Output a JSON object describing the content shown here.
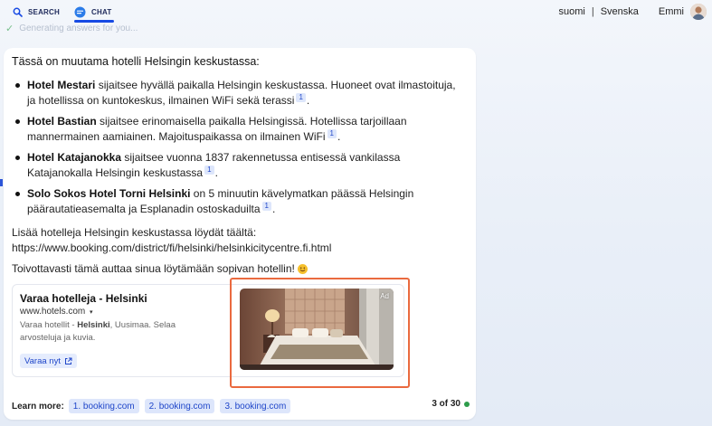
{
  "tabs": [
    {
      "label": "SEARCH",
      "icon": "search-icon"
    },
    {
      "label": "CHAT",
      "icon": "chat-icon",
      "active": true
    }
  ],
  "header": {
    "lang1": "suomi",
    "lang2": "Svenska",
    "user": "Emmi"
  },
  "ghost_text": "Generating answers for you...",
  "chat": {
    "intro": "Tässä on muutama hotelli Helsingin keskustassa:",
    "hotels": [
      {
        "name": "Hotel Mestari",
        "text": " sijaitsee hyvällä paikalla Helsingin keskustassa. Huoneet ovat ilmastoituja, ja hotellissa on kuntokeskus, ilmainen WiFi sekä terassi",
        "cite": "1",
        "end": "."
      },
      {
        "name": "Hotel Bastian",
        "text": " sijaitsee erinomaisella paikalla Helsingissä. Hotellissa tarjoillaan mannermainen aamiainen. Majoituspaikassa on ilmainen WiFi",
        "cite": "1",
        "end": "."
      },
      {
        "name": "Hotel Katajanokka",
        "text": " sijaitsee vuonna 1837 rakennetussa entisessä vankilassa Katajanokalla Helsingin keskustassa",
        "cite": "1",
        "end": "."
      },
      {
        "name": "Solo Sokos Hotel Torni Helsinki",
        "text": " on 5 minuutin kävelymatkan päässä Helsingin päärautatieasemalta ja Esplanadin ostoskaduilta",
        "cite": "1",
        "end": "."
      }
    ],
    "more_line1": "Lisää hotelleja Helsingin keskustassa löydät täältä:",
    "more_line2": "https://www.booking.com/district/fi/helsinki/helsinkicitycentre.fi.html",
    "closing": "Toivottavasti tämä auttaa sinua löytämään sopivan hotellin!"
  },
  "ad": {
    "title": "Varaa hotelleja - Helsinki",
    "url": "www.hotels.com",
    "desc_pre": "Varaa hotellit - ",
    "desc_bold": "Helsinki",
    "desc_post": ", Uusimaa. Selaa arvosteluja ja kuvia.",
    "button": "Varaa nyt",
    "badge": "Ad"
  },
  "learn_more": {
    "label": "Learn more:",
    "links": [
      "1. booking.com",
      "2. booking.com",
      "3. booking.com"
    ],
    "count": "3 of 30"
  },
  "colors": {
    "accent": "#174ae4",
    "highlight_frame": "#ea6a3f",
    "status_dot": "#2d9c4a"
  }
}
